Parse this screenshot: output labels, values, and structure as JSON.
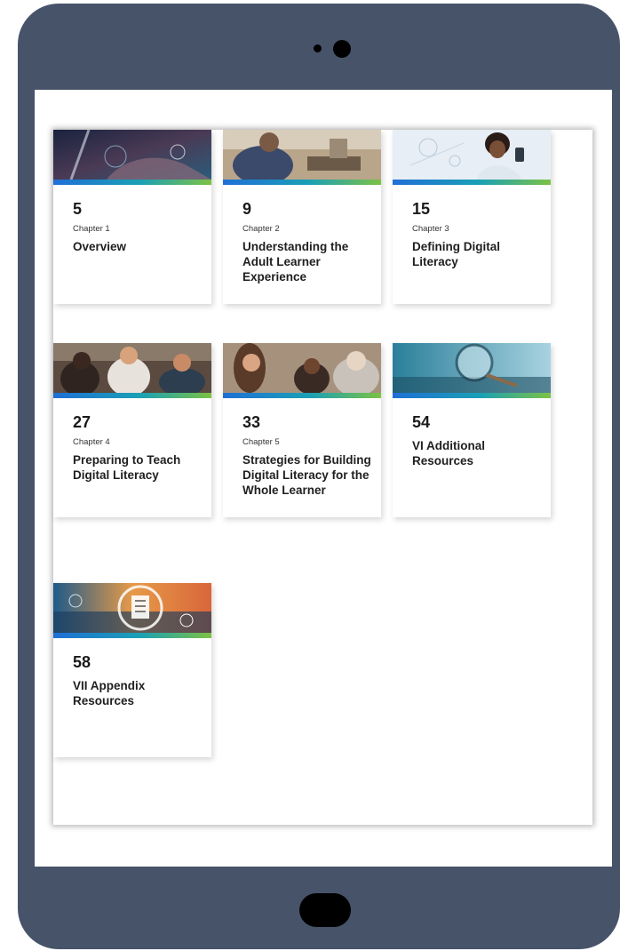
{
  "cards": [
    {
      "page": "5",
      "chapter": "Chapter 1",
      "title": "Overview"
    },
    {
      "page": "9",
      "chapter": "Chapter 2",
      "title": "Understanding the Adult Learner Experience"
    },
    {
      "page": "15",
      "chapter": "Chapter 3",
      "title": "Defining Digital Literacy"
    },
    {
      "page": "27",
      "chapter": "Chapter 4",
      "title": "Preparing to Teach Digital Literacy"
    },
    {
      "page": "33",
      "chapter": "Chapter 5",
      "title": "Strategies for Building Digital Literacy for the Whole Learner"
    },
    {
      "page": "54",
      "chapter": "",
      "title": "VI Additional Resources"
    },
    {
      "page": "58",
      "chapter": "",
      "title": "VII Appendix Resources"
    }
  ],
  "colors": {
    "device_frame": "#465369",
    "bar_blue": "#1f6fd6",
    "bar_green": "#7cc243"
  },
  "icons": [
    "camera-icon",
    "home-button-icon"
  ]
}
